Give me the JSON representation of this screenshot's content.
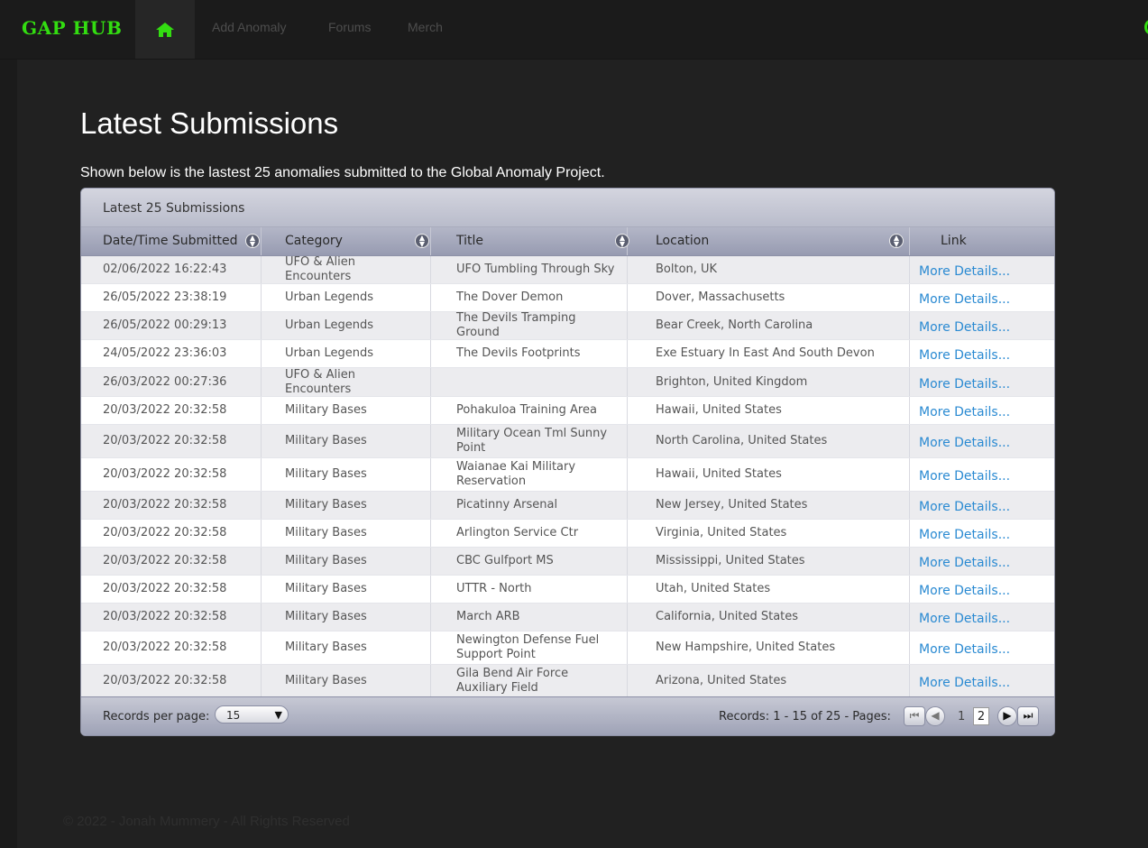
{
  "nav": {
    "brand": "GAP HUB",
    "home_icon": "home-icon",
    "links": [
      "Add Anomaly",
      "Forums",
      "Merch"
    ]
  },
  "colors": {
    "brand_green": "#33dd11",
    "link_blue": "#2a8ad2",
    "page_bg": "#212121"
  },
  "page": {
    "title": "Latest Submissions",
    "intro": "Shown below is the lastest 25 anomalies submitted to the Global Anomaly Project."
  },
  "grid": {
    "caption": "Latest 25 Submissions",
    "columns": [
      "Date/Time Submitted",
      "Category",
      "Title",
      "Location",
      "Link"
    ],
    "rows": [
      [
        "02/06/2022 16:22:43",
        "UFO & Alien Encounters",
        "UFO Tumbling Through Sky",
        "Bolton, UK",
        "More Details..."
      ],
      [
        "26/05/2022 23:38:19",
        "Urban Legends",
        "The Dover Demon",
        "Dover, Massachusetts",
        "More Details..."
      ],
      [
        "26/05/2022 00:29:13",
        "Urban Legends",
        "The Devils Tramping Ground",
        "Bear Creek, North Carolina",
        "More Details..."
      ],
      [
        "24/05/2022 23:36:03",
        "Urban Legends",
        "The Devils Footprints",
        "Exe Estuary In East And South Devon",
        "More Details..."
      ],
      [
        "26/03/2022 00:27:36",
        "UFO & Alien Encounters",
        "",
        "Brighton, United Kingdom",
        "More Details..."
      ],
      [
        "20/03/2022 20:32:58",
        "Military Bases",
        "Pohakuloa Training Area",
        "Hawaii, United States",
        "More Details..."
      ],
      [
        "20/03/2022 20:32:58",
        "Military Bases",
        "Military Ocean Tml Sunny Point",
        "North Carolina, United States",
        "More Details..."
      ],
      [
        "20/03/2022 20:32:58",
        "Military Bases",
        "Waianae Kai Military Reservation",
        "Hawaii, United States",
        "More Details..."
      ],
      [
        "20/03/2022 20:32:58",
        "Military Bases",
        "Picatinny Arsenal",
        "New Jersey, United States",
        "More Details..."
      ],
      [
        "20/03/2022 20:32:58",
        "Military Bases",
        "Arlington Service Ctr",
        "Virginia, United States",
        "More Details..."
      ],
      [
        "20/03/2022 20:32:58",
        "Military Bases",
        "CBC Gulfport MS",
        "Mississippi, United States",
        "More Details..."
      ],
      [
        "20/03/2022 20:32:58",
        "Military Bases",
        "UTTR - North",
        "Utah, United States",
        "More Details..."
      ],
      [
        "20/03/2022 20:32:58",
        "Military Bases",
        "March ARB",
        "California, United States",
        "More Details..."
      ],
      [
        "20/03/2022 20:32:58",
        "Military Bases",
        "Newington Defense Fuel Support Point",
        "New Hampshire, United States",
        "More Details..."
      ],
      [
        "20/03/2022 20:32:58",
        "Military Bases",
        "Gila Bend Air Force Auxiliary Field",
        "Arizona, United States",
        "More Details..."
      ]
    ],
    "footer": {
      "records_per_page_label": "Records per page:",
      "records_per_page_value": "15",
      "records_summary": "Records: 1 - 15 of 25 - Pages:",
      "pages": [
        "1",
        "2"
      ],
      "current_page": "2"
    }
  },
  "footer": {
    "copyright": "© 2022 - Jonah Mummery - All Rights Reserved"
  }
}
